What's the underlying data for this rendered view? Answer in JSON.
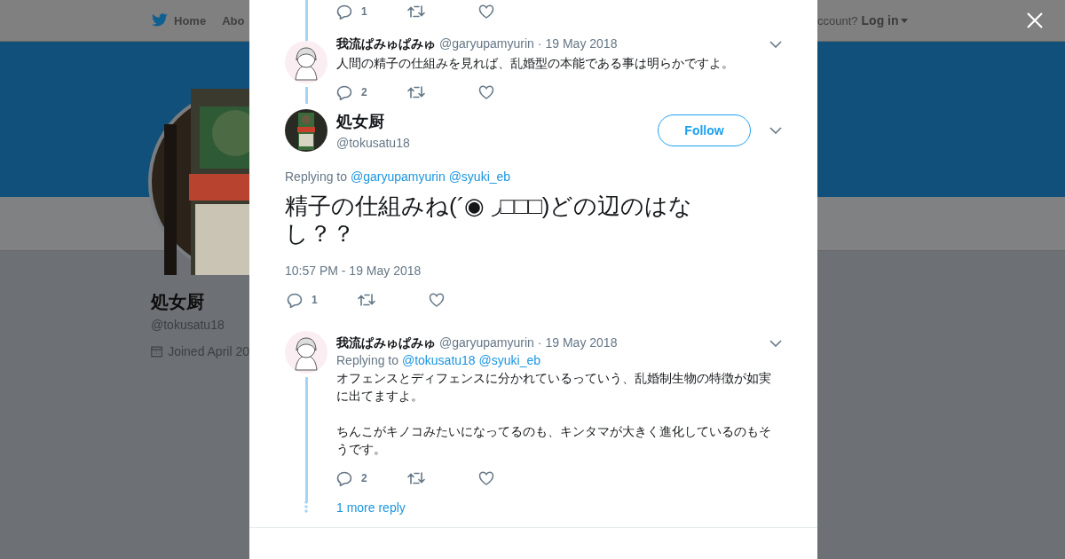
{
  "background": {
    "nav": [
      {
        "label": "Home"
      },
      {
        "label": "Abo"
      }
    ],
    "account_prompt": "ccount?",
    "login": "Log in",
    "profile": {
      "name": "処女厨",
      "handle": "@tokusatu18",
      "joined": "Joined April 20"
    }
  },
  "thread": {
    "previous_actions": {
      "replies": "1"
    },
    "replies_above": [
      {
        "name": "我流ぱみゅぱみゅ",
        "handle": "@garyupamyurin",
        "separator": "·",
        "date": "19 May 2018",
        "text": [
          "人間の精子の仕組みを見れば、乱婚型の本能である事は明らかですよ。"
        ],
        "replies": "2"
      }
    ],
    "main_tweet": {
      "name": "処女厨",
      "handle": "@tokusatu18",
      "follow_button": "Follow",
      "replying_to_label": "Replying to",
      "replying_to": [
        "@garyupamyurin",
        "@syuki_eb"
      ],
      "text": "精子の仕組みね(´◉ ◞□□□)どの辺のはなし？？",
      "timestamp": "10:57 PM - 19 May 2018",
      "replies": "1"
    },
    "replies_below": [
      {
        "name": "我流ぱみゅぱみゅ",
        "handle": "@garyupamyurin",
        "separator": "·",
        "date": "19 May 2018",
        "replying_to_label": "Replying to",
        "replying_to": [
          "@tokusatu18",
          "@syuki_eb"
        ],
        "text": [
          "オフェンスとディフェンスに分かれているっていう、乱婚制生物の特徴が如実に出てますよ。",
          "ちんこがキノコみたいになってるのも、キンタマが大きく進化しているのもそうです。"
        ],
        "replies": "2",
        "more_replies": "1 more reply"
      }
    ]
  }
}
